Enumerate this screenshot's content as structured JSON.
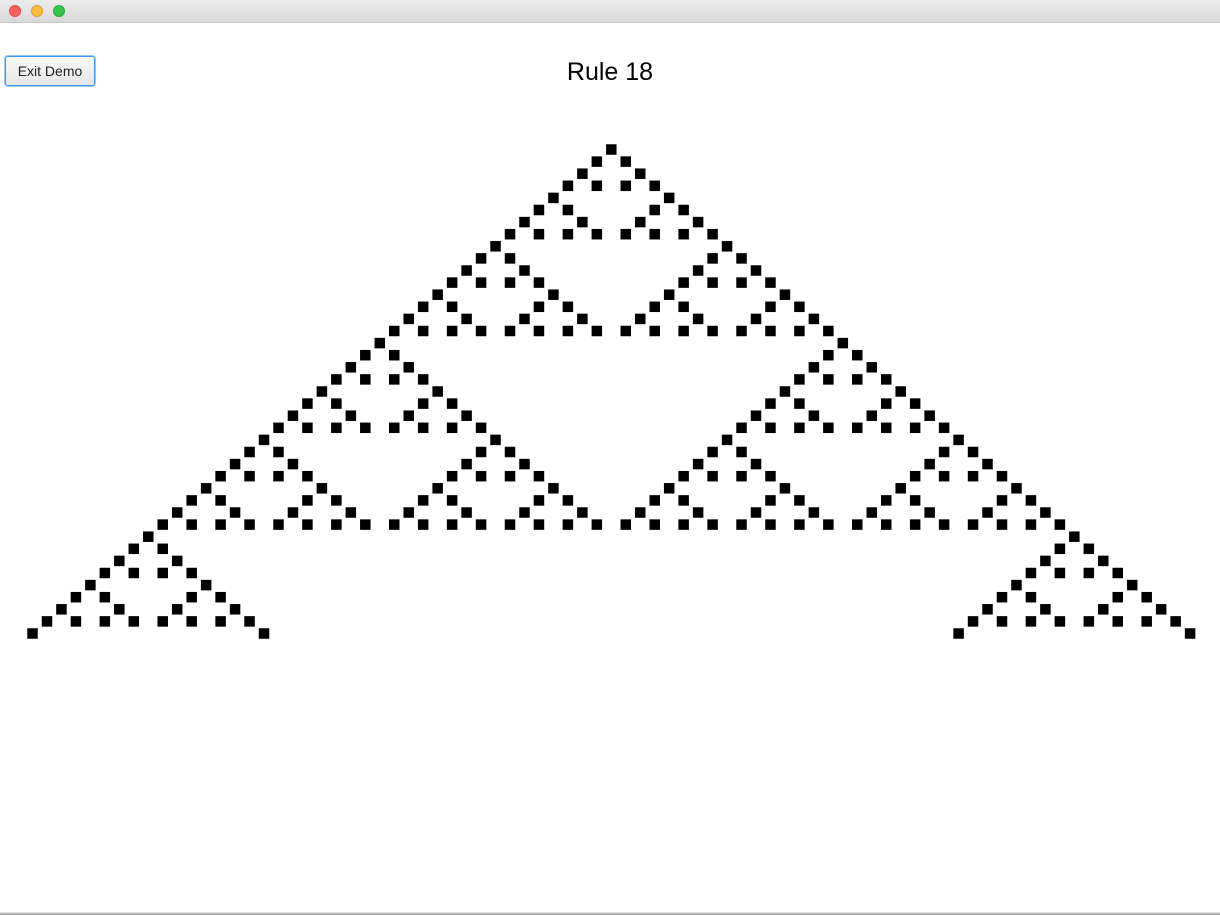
{
  "window": {
    "controls": [
      "close-button",
      "minimize-button",
      "maximize-button"
    ]
  },
  "toolbar": {
    "exit_label": "Exit Demo"
  },
  "main": {
    "title": "Rule 18"
  },
  "automaton": {
    "rule": 18,
    "generations": 41,
    "visible_columns": 81,
    "cell_color": "#000000",
    "background_color": "#ffffff"
  }
}
